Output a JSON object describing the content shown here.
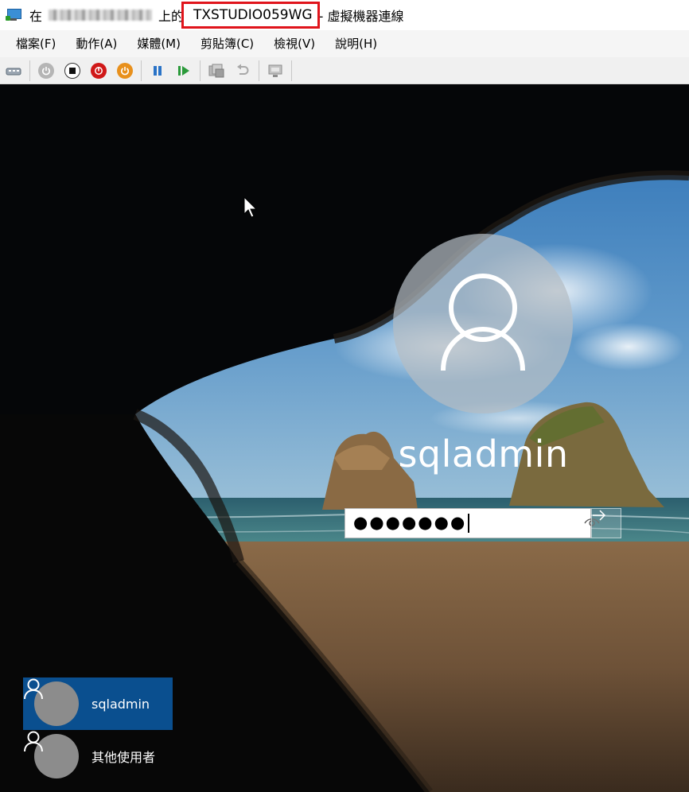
{
  "window": {
    "title_prefix": "在",
    "title_mid": "上的",
    "vm_name": "TXSTUDIO059WG",
    "title_suffix": "- 虛擬機器連線"
  },
  "menu": [
    "檔案(F)",
    "動作(A)",
    "媒體(M)",
    "剪貼簿(C)",
    "檢視(V)",
    "說明(H)"
  ],
  "toolbar": [
    "ctrl-alt-del-icon",
    "start-icon",
    "turn-off-icon",
    "shutdown-icon",
    "reset-icon",
    "pause-icon",
    "resume-icon",
    "checkpoint-icon",
    "revert-icon",
    "enhanced-session-icon"
  ],
  "login": {
    "username": "sqladmin",
    "password_masked": "●●●●●●●"
  },
  "users": [
    {
      "name": "sqladmin",
      "selected": true
    },
    {
      "name": "其他使用者",
      "selected": false
    }
  ],
  "colors": {
    "highlight": "#e0141b",
    "selected_tile": "#0a4f8f"
  }
}
